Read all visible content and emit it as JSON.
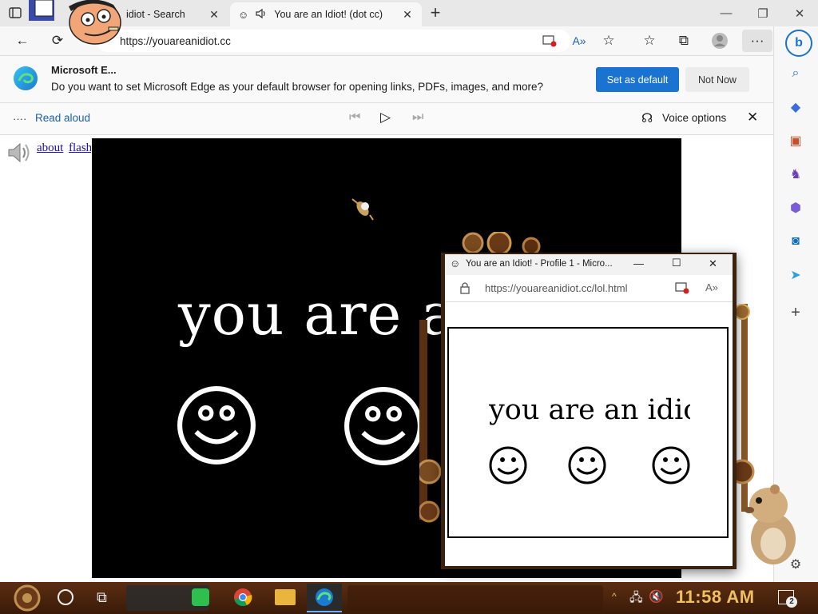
{
  "tabs": [
    {
      "title": "idiot - Search"
    },
    {
      "title": "You are an Idiot! (dot cc)"
    }
  ],
  "address": {
    "url": "https://youareanidiot.cc"
  },
  "notification": {
    "title": "Microsoft E...",
    "message": "Do you want to set Microsoft Edge as your default browser for opening links, PDFs, images, and more?",
    "primary_label": "Set as default",
    "secondary_label": "Not Now"
  },
  "read_aloud": {
    "label": "Read aloud",
    "voice_options": "Voice options"
  },
  "page": {
    "links": [
      "about",
      "flash"
    ],
    "headline": "you are an idiot"
  },
  "popup": {
    "title": "You are an Idiot! - Profile 1 - Micro...",
    "url": "https://youareanidiot.cc/lol.html",
    "text": "you are an idiot"
  },
  "taskbar": {
    "time": "11:58 AM",
    "notification_count": "2"
  },
  "colors": {
    "accent": "#1a73d0",
    "page_bg": "#000000",
    "taskbar": "#4a240d",
    "clock": "#f0c060"
  }
}
